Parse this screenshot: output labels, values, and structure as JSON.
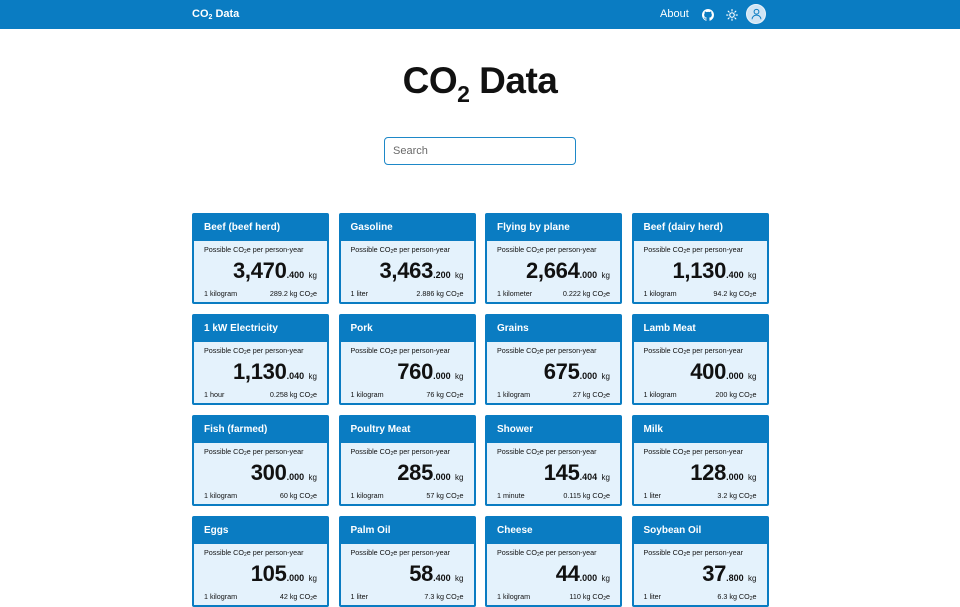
{
  "navbar": {
    "brand": "CO",
    "brand_sub": "2",
    "brand_rest": " Data",
    "about_label": "About",
    "icons": [
      "github-icon",
      "sun-icon",
      "user-icon"
    ],
    "color": "#0a7cc2"
  },
  "title": {
    "main": "CO",
    "sub": "2",
    "rest": " Data"
  },
  "search": {
    "placeholder": "Search",
    "value": ""
  },
  "card_caption": "Possible CO2e per person-year",
  "cards": [
    {
      "name": "Beef (beef herd)",
      "int": "3,470",
      "dec": ".400",
      "unit": "kg",
      "per": "1 kilogram",
      "ref": "289.2 kg CO2e"
    },
    {
      "name": "Gasoline",
      "int": "3,463",
      "dec": ".200",
      "unit": "kg",
      "per": "1 liter",
      "ref": "2.886 kg CO2e"
    },
    {
      "name": "Flying by plane",
      "int": "2,664",
      "dec": ".000",
      "unit": "kg",
      "per": "1 kilometer",
      "ref": "0.222 kg CO2e"
    },
    {
      "name": "Beef (dairy herd)",
      "int": "1,130",
      "dec": ".400",
      "unit": "kg",
      "per": "1 kilogram",
      "ref": "94.2 kg CO2e"
    },
    {
      "name": "1 kW Electricity",
      "int": "1,130",
      "dec": ".040",
      "unit": "kg",
      "per": "1 hour",
      "ref": "0.258 kg CO2e"
    },
    {
      "name": "Pork",
      "int": "760",
      "dec": ".000",
      "unit": "kg",
      "per": "1 kilogram",
      "ref": "76 kg CO2e"
    },
    {
      "name": "Grains",
      "int": "675",
      "dec": ".000",
      "unit": "kg",
      "per": "1 kilogram",
      "ref": "27 kg CO2e"
    },
    {
      "name": "Lamb Meat",
      "int": "400",
      "dec": ".000",
      "unit": "kg",
      "per": "1 kilogram",
      "ref": "200 kg CO2e"
    },
    {
      "name": "Fish (farmed)",
      "int": "300",
      "dec": ".000",
      "unit": "kg",
      "per": "1 kilogram",
      "ref": "60 kg CO2e"
    },
    {
      "name": "Poultry Meat",
      "int": "285",
      "dec": ".000",
      "unit": "kg",
      "per": "1 kilogram",
      "ref": "57 kg CO2e"
    },
    {
      "name": "Shower",
      "int": "145",
      "dec": ".404",
      "unit": "kg",
      "per": "1 minute",
      "ref": "0.115 kg CO2e"
    },
    {
      "name": "Milk",
      "int": "128",
      "dec": ".000",
      "unit": "kg",
      "per": "1 liter",
      "ref": "3.2 kg CO2e"
    },
    {
      "name": "Eggs",
      "int": "105",
      "dec": ".000",
      "unit": "kg",
      "per": "1 kilogram",
      "ref": "42 kg CO2e"
    },
    {
      "name": "Palm Oil",
      "int": "58",
      "dec": ".400",
      "unit": "kg",
      "per": "1 liter",
      "ref": "7.3 kg CO2e"
    },
    {
      "name": "Cheese",
      "int": "44",
      "dec": ".000",
      "unit": "kg",
      "per": "1 kilogram",
      "ref": "110 kg CO2e"
    },
    {
      "name": "Soybean Oil",
      "int": "37",
      "dec": ".800",
      "unit": "kg",
      "per": "1 liter",
      "ref": "6.3 kg CO2e"
    }
  ]
}
